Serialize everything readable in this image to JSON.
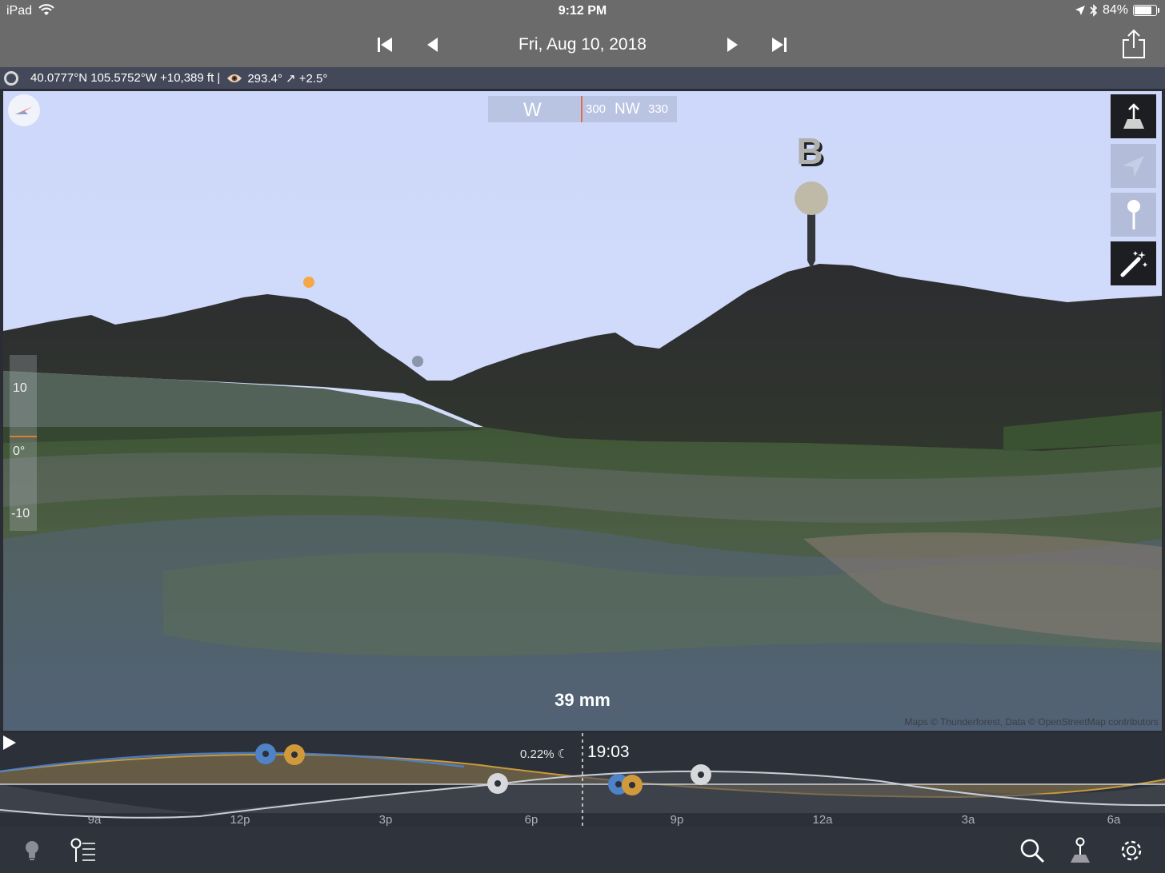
{
  "status_bar": {
    "device": "iPad",
    "time": "9:12 PM",
    "battery": "84%",
    "battery_level": 0.84
  },
  "nav": {
    "date": "Fri, Aug 10, 2018"
  },
  "info_bar": {
    "location": "40.0777°N 105.5752°W +10,389 ft |",
    "view": "293.4° ↗ +2.5°"
  },
  "viewport": {
    "compass": {
      "major": "W",
      "tick1": "300",
      "direction": "NW",
      "tick2": "330"
    },
    "marker_label": "B",
    "focal_length": "39 mm",
    "attribution": "Maps © Thunderforest, Data © OpenStreetMap contributors",
    "elevation_scale": [
      "10",
      "0°",
      "-10"
    ],
    "sky_color": "#cbd6f7",
    "terrain_color": "#2e2f33"
  },
  "timeline": {
    "moon_illumination": "0.22%",
    "cursor_time": "19:03",
    "hours": [
      "9a",
      "12p",
      "3p",
      "6p",
      "9p",
      "12a",
      "3a",
      "6a"
    ],
    "sun_color": "#d09a3c",
    "moon_color": "#4f82c7"
  },
  "toolbar": {
    "left_icons": [
      "lightbulb-icon",
      "pin-list-icon"
    ],
    "right_icons": [
      "search-icon",
      "map-pin-icon",
      "gear-icon"
    ]
  }
}
